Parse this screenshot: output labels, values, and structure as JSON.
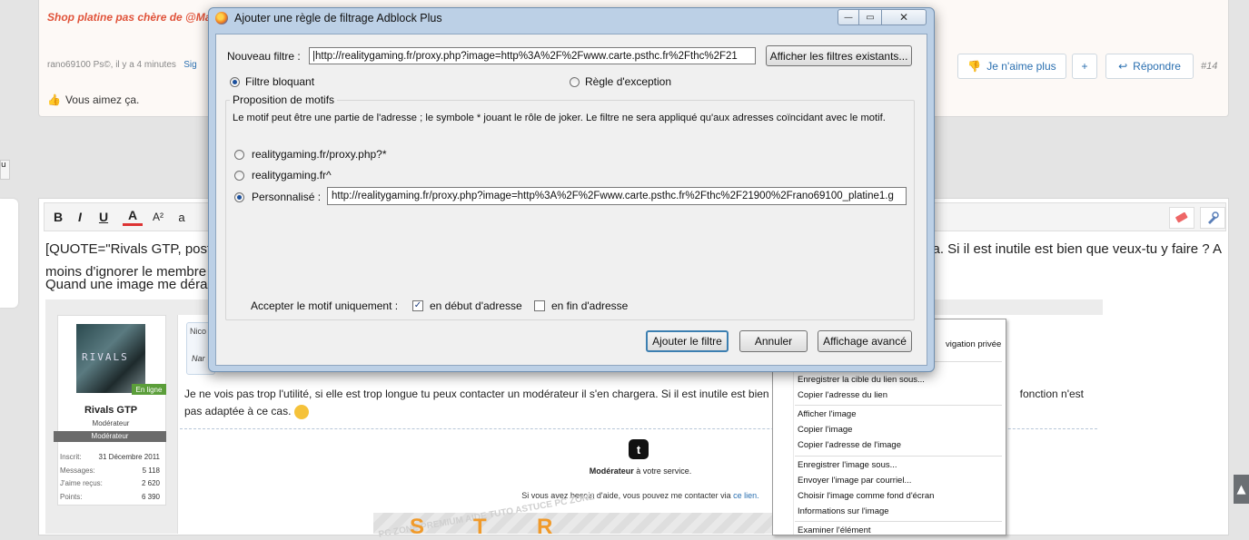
{
  "forum": {
    "post_title": "Shop platine pas chère de @Ma",
    "post_meta": "rano69100 Ps©, il y a 4 minutes",
    "post_meta_sig": "Sig",
    "dislike_label": "Je n'aime plus",
    "plus_label": "+",
    "reply_label": "Répondre",
    "post_number": "#14",
    "like_text": "Vous aimez ça.",
    "left_tab_text": "u",
    "editor_line1_start": "[QUOTE=\"Rivals GTP, post",
    "editor_line1_end": "ra. Si il est inutile est bien que veux-tu y faire ? A",
    "editor_line2": "moins d'ignorer le membre",
    "editor_line3": "Quand une image me dérar",
    "quote_head_title": "Nico",
    "quote_head_name": "Nar",
    "body_text_1": "Je ne vois pas trop l'utilité, si elle est trop longue tu peux contacter un modérateur il s'en chargera. Si il est inutile est bien que veu",
    "body_text_1_end": "fonction n'est",
    "body_text_2": "pas adaptée à ce cas.",
    "sig_role": "Modérateur",
    "sig_service": " à votre service.",
    "sig_help": "Si vous avez besoin d'aide, vous pouvez me contacter via ",
    "sig_link": "ce lien.",
    "banner_letters": [
      "S",
      "T",
      "R"
    ],
    "banner_watermark": "PC ZONE   PREMIUM AIDE TUTO ASTUCE PC ZONE"
  },
  "user_card": {
    "name": "Rivals GTP",
    "role": "Modérateur",
    "banner": "Modérateur",
    "online_badge": "En ligne",
    "avatar_text": "RIVALS",
    "stats": [
      {
        "label": "Inscrit:",
        "value": "31 Décembre 2011"
      },
      {
        "label": "Messages:",
        "value": "5 118"
      },
      {
        "label": "J'aime reçus:",
        "value": "2 620"
      },
      {
        "label": "Points:",
        "value": "6 390"
      }
    ]
  },
  "editor_toolbar": {
    "bold": "B",
    "italic": "I",
    "underline": "U",
    "font_color": "A",
    "font_size": "A²",
    "font_family": "a"
  },
  "context_menu": {
    "items": [
      "vigation privée",
      "Enregistrer la cible du lien sous...",
      "Copier l'adresse du lien",
      "Afficher l'image",
      "Copier l'image",
      "Copier l'adresse de l'image",
      "Enregistrer l'image sous...",
      "Envoyer l'image par courriel...",
      "Choisir l'image comme fond d'écran",
      "Informations sur l'image",
      "Examiner l'élément"
    ]
  },
  "dialog": {
    "title": "Ajouter une règle de filtrage Adblock Plus",
    "new_filter_label": "Nouveau filtre :",
    "new_filter_value": "|http://realitygaming.fr/proxy.php?image=http%3A%2F%2Fwww.carte.psthc.fr%2Fthc%2F21",
    "show_filters_button": "Afficher les filtres existants...",
    "blocking_filter": "Filtre bloquant",
    "exception_rule": "Règle d'exception",
    "group_title": "Proposition de motifs",
    "description": "Le motif peut être une partie de l'adresse ; le symbole * jouant le rôle de joker. Le filtre ne sera appliqué qu'aux adresses coïncidant avec le motif.",
    "option1": "realitygaming.fr/proxy.php?*",
    "option2": "realitygaming.fr^",
    "custom_label": "Personnalisé :",
    "custom_value": "http://realitygaming.fr/proxy.php?image=http%3A%2F%2Fwww.carte.psthc.fr%2Fthc%2F21900%2Frano69100_platine1.g",
    "accept_label": "Accepter le motif uniquement :",
    "start_option": "en début d'adresse",
    "end_option": "en fin d'adresse",
    "add_button": "Ajouter le filtre",
    "cancel_button": "Annuler",
    "advanced_button": "Affichage avancé"
  },
  "colors": {
    "accent_orange": "#e0533a",
    "link_blue": "#2a6fb0",
    "online_green": "#5b9e3a",
    "dialog_frame": "#bcd0e6"
  }
}
